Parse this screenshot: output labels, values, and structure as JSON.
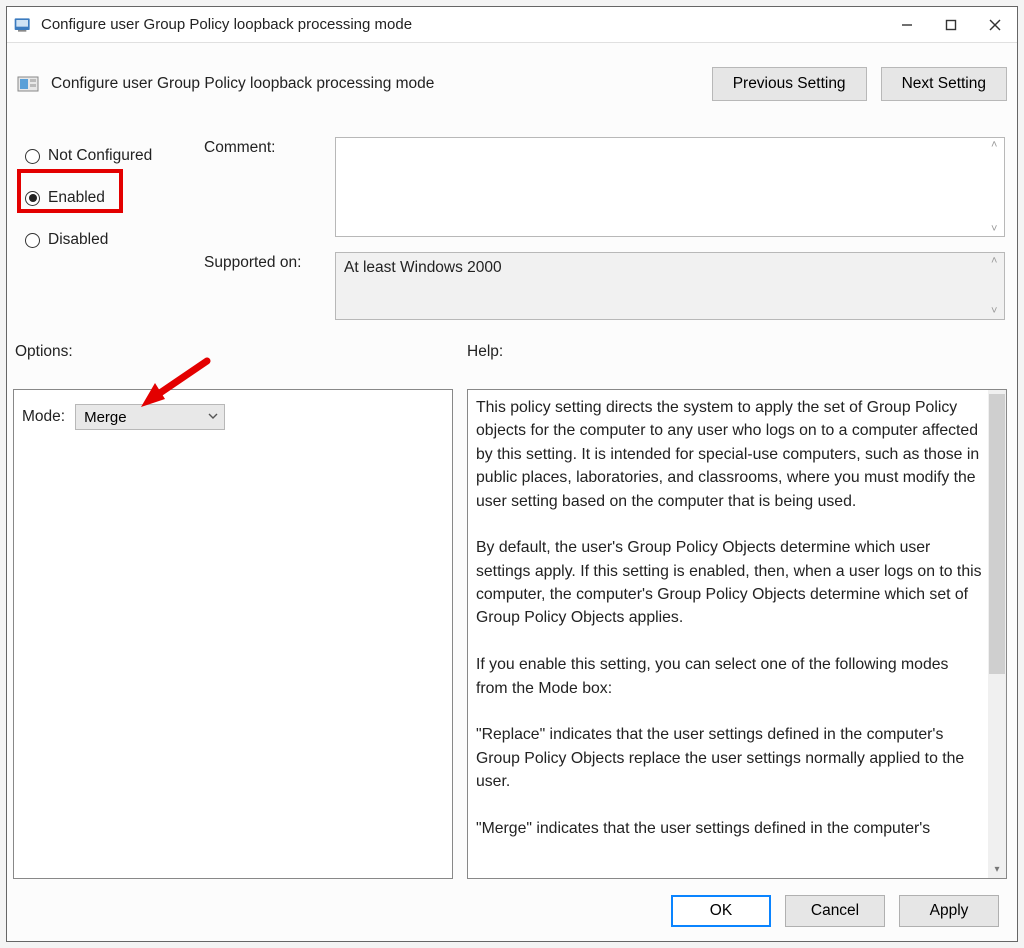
{
  "window": {
    "title": "Configure user Group Policy loopback processing mode"
  },
  "header": {
    "title": "Configure user Group Policy loopback processing mode",
    "previous_btn": "Previous Setting",
    "next_btn": "Next Setting"
  },
  "state": {
    "radios": {
      "not_configured": "Not Configured",
      "enabled": "Enabled",
      "disabled": "Disabled",
      "selected": "enabled"
    },
    "comment_label": "Comment:",
    "comment_value": "",
    "supported_label": "Supported on:",
    "supported_value": "At least Windows 2000"
  },
  "sections": {
    "options_label": "Options:",
    "help_label": "Help:"
  },
  "options": {
    "mode_label": "Mode:",
    "mode_value": "Merge"
  },
  "help": {
    "text": "This policy setting directs the system to apply the set of Group Policy objects for the computer to any user who logs on to a computer affected by this setting. It is intended for special-use computers, such as those in public places, laboratories, and classrooms, where you must modify the user setting based on the computer that is being used.\n\nBy default, the user's Group Policy Objects determine which user settings apply. If this setting is enabled, then, when a user logs on to this computer, the computer's Group Policy Objects determine which set of Group Policy Objects applies.\n\nIf you enable this setting, you can select one of the following modes from the Mode box:\n\n\"Replace\" indicates that the user settings defined in the computer's Group Policy Objects replace the user settings normally applied to the user.\n\n\"Merge\" indicates that the user settings defined in the computer's"
  },
  "buttons": {
    "ok": "OK",
    "cancel": "Cancel",
    "apply": "Apply"
  }
}
